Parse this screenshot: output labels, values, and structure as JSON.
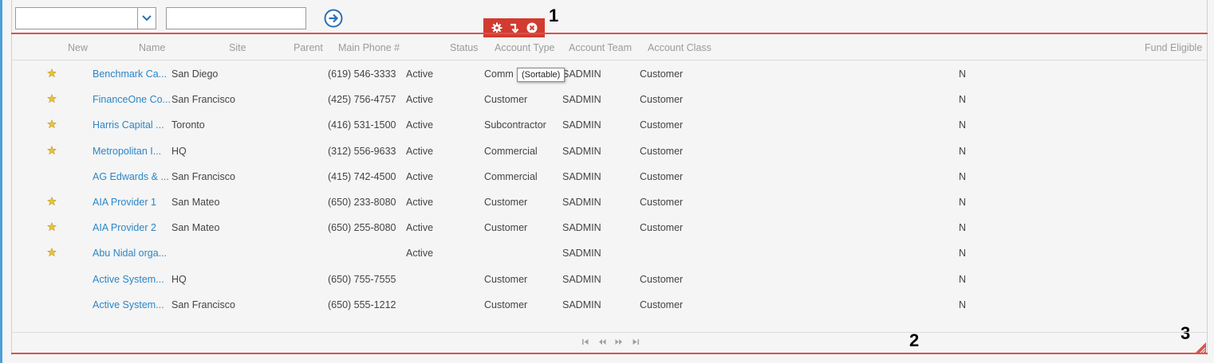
{
  "query_bar": {
    "select_value": "",
    "text_value": "",
    "go_icon": "arrow-right-circle-icon"
  },
  "toolbar": {
    "icons": [
      "gear-icon",
      "arrow-down-right-icon",
      "close-circle-icon"
    ],
    "color": "#d23b30"
  },
  "markers": [
    "1",
    "2",
    "3"
  ],
  "columns": [
    "New",
    "Name",
    "Site",
    "Parent",
    "Main Phone #",
    "Status",
    "Account Type",
    "Account Team",
    "Account Class",
    "Fund Eligible"
  ],
  "tooltip": "(Sortable)",
  "rows": [
    {
      "starred": true,
      "name": "Benchmark Ca...",
      "site": "San Diego",
      "phone": "(619) 546-3333",
      "status": "Active",
      "type": "Comm",
      "team": "SADMIN",
      "class": "Customer",
      "fund": "N"
    },
    {
      "starred": true,
      "name": "FinanceOne Co...",
      "site": "San Francisco",
      "phone": "(425) 756-4757",
      "status": "Active",
      "type": "Customer",
      "team": "SADMIN",
      "class": "Customer",
      "fund": "N"
    },
    {
      "starred": true,
      "name": "Harris Capital ...",
      "site": "Toronto",
      "phone": "(416) 531-1500",
      "status": "Active",
      "type": "Subcontractor",
      "team": "SADMIN",
      "class": "Customer",
      "fund": "N"
    },
    {
      "starred": true,
      "name": "Metropolitan I...",
      "site": "HQ",
      "phone": "(312) 556-9633",
      "status": "Active",
      "type": "Commercial",
      "team": "SADMIN",
      "class": "Customer",
      "fund": "N"
    },
    {
      "starred": false,
      "name": "AG Edwards & ...",
      "site": "San Francisco",
      "phone": "(415) 742-4500",
      "status": "Active",
      "type": "Commercial",
      "team": "SADMIN",
      "class": "Customer",
      "fund": "N"
    },
    {
      "starred": true,
      "name": "AIA Provider 1",
      "site": "San Mateo",
      "phone": "(650) 233-8080",
      "status": "Active",
      "type": "Customer",
      "team": "SADMIN",
      "class": "Customer",
      "fund": "N"
    },
    {
      "starred": true,
      "name": "AIA Provider 2",
      "site": "San Mateo",
      "phone": "(650) 255-8080",
      "status": "Active",
      "type": "Customer",
      "team": "SADMIN",
      "class": "Customer",
      "fund": "N"
    },
    {
      "starred": true,
      "name": "Abu Nidal orga...",
      "site": "",
      "phone": "",
      "status": "Active",
      "type": "",
      "team": "SADMIN",
      "class": "",
      "fund": "N"
    },
    {
      "starred": false,
      "name": "Active System...",
      "site": "HQ",
      "phone": "(650) 755-7555",
      "status": "",
      "type": "Customer",
      "team": "SADMIN",
      "class": "Customer",
      "fund": "N"
    },
    {
      "starred": false,
      "name": "Active System...",
      "site": "San Francisco",
      "phone": "(650) 555-1212",
      "status": "",
      "type": "Customer",
      "team": "SADMIN",
      "class": "Customer",
      "fund": "N"
    }
  ],
  "pager": {
    "icons": [
      "first-page-icon",
      "previous-page-icon",
      "next-page-icon",
      "last-page-icon"
    ]
  },
  "colors": {
    "accent_red": "#d9534f",
    "link_blue": "#2a86c8",
    "star_gold": "#e8c23a",
    "frame_blue": "#4a9fd8"
  }
}
